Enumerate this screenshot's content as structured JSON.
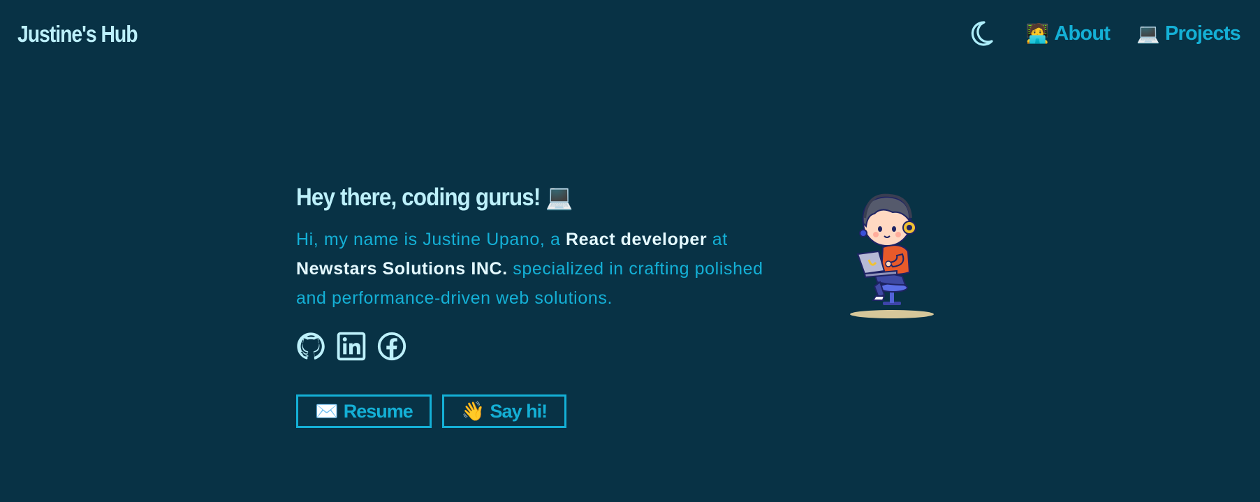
{
  "header": {
    "brand": "Justine's Hub",
    "theme_toggle_icon": "moon-icon",
    "nav": [
      {
        "emoji": "🧑‍💻",
        "label": "About"
      },
      {
        "emoji": "💻",
        "label": "Projects"
      }
    ]
  },
  "hero": {
    "greeting": "Hey there, coding gurus! 💻",
    "intro_1": "Hi, my name is Justine Upano, a ",
    "intro_bold_1": "React developer",
    "intro_2": " at ",
    "intro_bold_2": "Newstars Solutions INC.",
    "intro_3": " specialized in crafting polished and performance-driven web solutions.",
    "socials": [
      "github-icon",
      "linkedin-icon",
      "facebook-icon"
    ],
    "buttons": {
      "resume_emoji": "✉️",
      "resume_label": "Resume",
      "sayhi_emoji": "👋",
      "sayhi_label": "Say hi!"
    }
  },
  "colors": {
    "background": "#083245",
    "accent": "#14b0d6",
    "heading": "#bdf0fa",
    "emphasis": "#e4f9ff"
  }
}
